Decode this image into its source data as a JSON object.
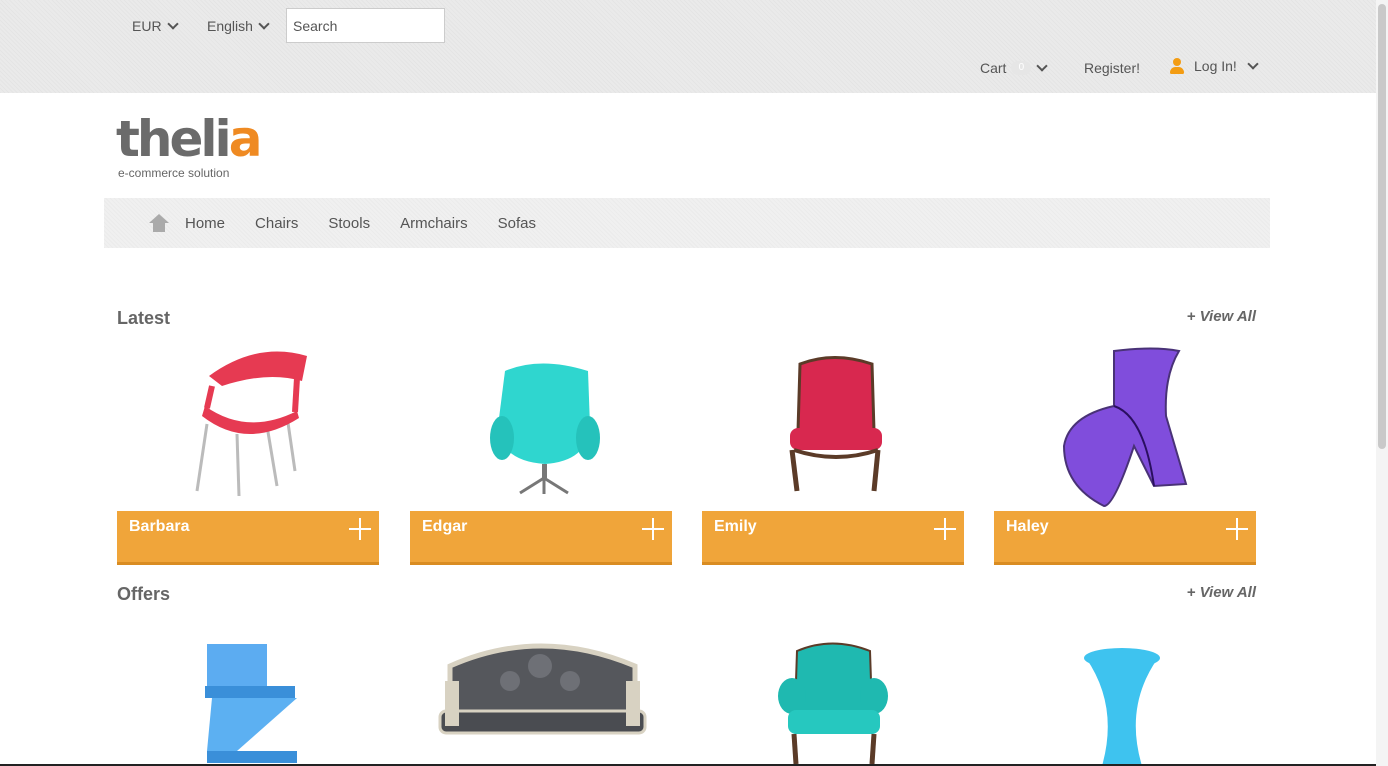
{
  "topbar": {
    "currency": "EUR",
    "language": "English",
    "search_placeholder": "Search",
    "cart_label": "Cart",
    "cart_count": "0",
    "register_label": "Register!",
    "login_label": "Log In!"
  },
  "logo": {
    "word_start": "theli",
    "word_end": "a",
    "tagline": "e-commerce solution"
  },
  "nav": {
    "items": [
      "Home",
      "Chairs",
      "Stools",
      "Armchairs",
      "Sofas"
    ]
  },
  "latest": {
    "title": "Latest",
    "view_all": "+ View All",
    "products": [
      {
        "name": "Barbara",
        "color": "#e63a52"
      },
      {
        "name": "Edgar",
        "color": "#2fd6cf"
      },
      {
        "name": "Emily",
        "color": "#d8284f"
      },
      {
        "name": "Haley",
        "color": "#6b2fd6"
      }
    ]
  },
  "offers": {
    "title": "Offers",
    "view_all": "+ View All",
    "products": [
      {
        "color": "#4aa3ef"
      },
      {
        "color": "#55575c"
      },
      {
        "color": "#1fb9b0"
      },
      {
        "color": "#3ec3ef"
      }
    ]
  },
  "colors": {
    "accent": "#f0a53a",
    "logo_orange": "#ef8a22"
  }
}
